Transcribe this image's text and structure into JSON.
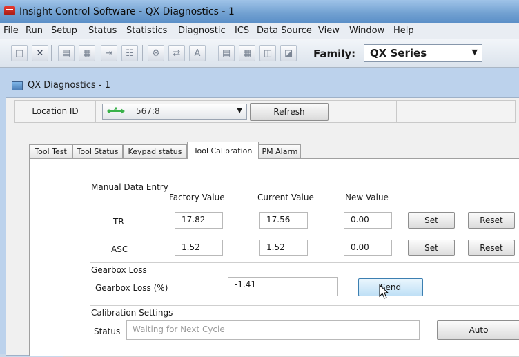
{
  "app": {
    "title": "Insight Control Software - QX Diagnostics - 1"
  },
  "menu": [
    "File",
    "Run",
    "Setup",
    "Status",
    "Statistics",
    "Diagnostic",
    "ICS",
    "Data Source",
    "View",
    "Window",
    "Help"
  ],
  "toolbar": {
    "icons": [
      "new-document-icon",
      "close-icon",
      "print-icon",
      "grid-icon",
      "import-icon",
      "export-icon",
      "settings-icon",
      "transfer-icon",
      "font-icon",
      "report-icon",
      "table-icon",
      "layout-icon",
      "window-icon"
    ],
    "family_label": "Family:",
    "family_value": "QX Series"
  },
  "child_window": {
    "title": "QX Diagnostics - 1"
  },
  "location": {
    "label": "Location ID",
    "value": "567:8",
    "refresh_label": "Refresh"
  },
  "tabs": [
    {
      "label": "Tool Test",
      "active": false
    },
    {
      "label": "Tool Status",
      "active": false
    },
    {
      "label": "Keypad status",
      "active": false
    },
    {
      "label": "Tool Calibration",
      "active": true
    },
    {
      "label": "PM Alarm",
      "active": false
    }
  ],
  "manual_entry": {
    "title": "Manual Data Entry",
    "columns": [
      "Factory Value",
      "Current Value",
      "New Value"
    ],
    "rows": [
      {
        "label": "TR",
        "factory": "17.82",
        "current": "17.56",
        "new": "0.00",
        "set": "Set",
        "reset": "Reset"
      },
      {
        "label": "ASC",
        "factory": "1.52",
        "current": "1.52",
        "new": "0.00",
        "set": "Set",
        "reset": "Reset"
      }
    ]
  },
  "gearbox": {
    "title": "Gearbox Loss",
    "label": "Gearbox Loss (%)",
    "value": "-1.41",
    "send_label": "Send"
  },
  "calibration": {
    "title": "Calibration Settings",
    "status_label": "Status",
    "status_value": "Waiting for Next Cycle",
    "auto_label": "Auto"
  }
}
